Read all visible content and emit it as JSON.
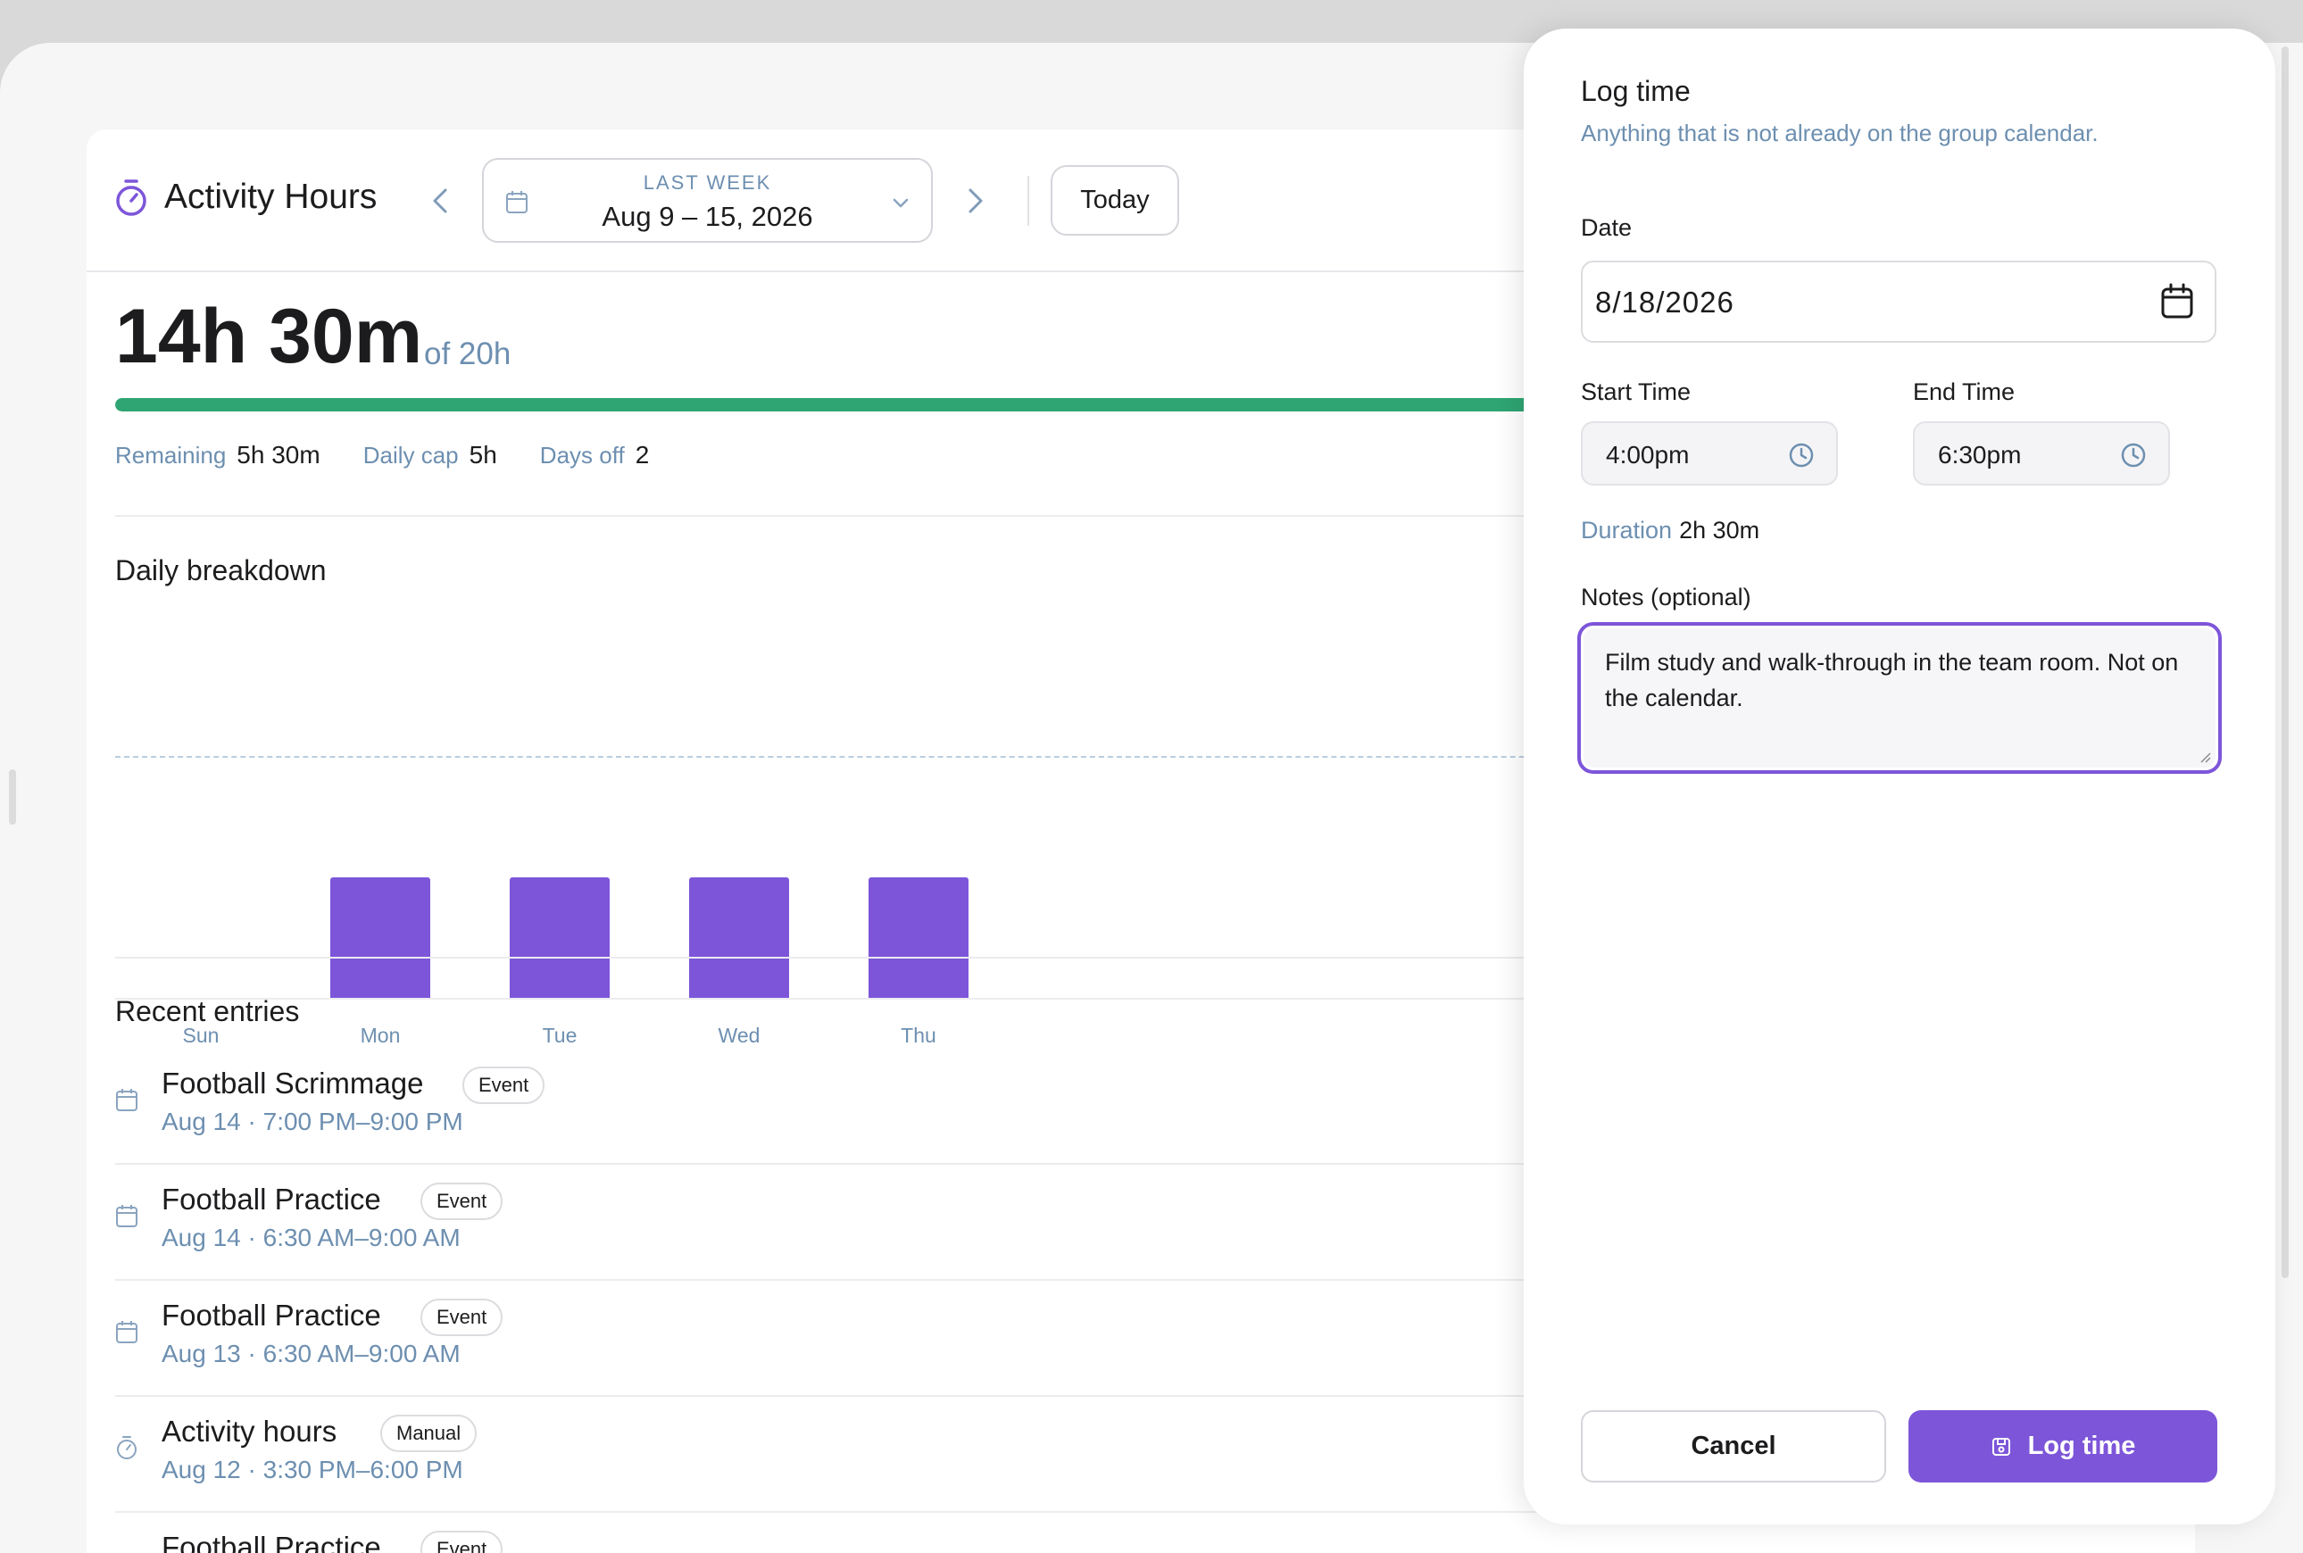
{
  "colors": {
    "accent": "#7d55d9",
    "progress": "#2ea572",
    "muted_text": "#6d8fb0",
    "text": "#1c1c1e",
    "border": "#d5d5db"
  },
  "header": {
    "icon": "stopwatch-icon",
    "title": "Activity Hours",
    "prev_icon": "chevron-left-icon",
    "next_icon": "chevron-right-icon",
    "week_select": {
      "icon": "calendar-icon",
      "caption": "LAST WEEK",
      "value": "Aug 9 – 15, 2026",
      "dropdown_icon": "chevron-down-icon"
    },
    "today_label": "Today"
  },
  "summary": {
    "total": "14h 30m",
    "of_total": "of 20h",
    "progress_fraction": 0.725,
    "stats": [
      {
        "label": "Remaining",
        "value": "5h 30m"
      },
      {
        "label": "Daily cap",
        "value": "5h"
      },
      {
        "label": "Days off",
        "value": "2"
      }
    ]
  },
  "breakdown": {
    "title": "Daily breakdown"
  },
  "chart_data": {
    "type": "bar",
    "categories": [
      "Sun",
      "Mon",
      "Tue",
      "Wed",
      "Thu"
    ],
    "values": [
      0,
      2.5,
      2.5,
      2.5,
      2.5
    ],
    "units": "hours",
    "daily_cap": 5,
    "ylim": [
      0,
      6
    ],
    "grid": false,
    "cap_line": "dashed"
  },
  "entries": {
    "title": "Recent entries",
    "items": [
      {
        "icon": "calendar-icon",
        "title": "Football Scrimmage",
        "tag": "Event",
        "subtitle": "Aug 14 · 7:00 PM–9:00 PM"
      },
      {
        "icon": "calendar-icon",
        "title": "Football Practice",
        "tag": "Event",
        "subtitle": "Aug 14 · 6:30 AM–9:00 AM"
      },
      {
        "icon": "calendar-icon",
        "title": "Football Practice",
        "tag": "Event",
        "subtitle": "Aug 13 · 6:30 AM–9:00 AM"
      },
      {
        "icon": "stopwatch-icon",
        "title": "Activity hours",
        "tag": "Manual",
        "subtitle": "Aug 12 · 3:30 PM–6:00 PM"
      },
      {
        "icon": "calendar-icon",
        "title": "Football Practice",
        "tag": "Event",
        "subtitle": ""
      }
    ]
  },
  "panel": {
    "title": "Log time",
    "subtitle": "Anything that is not already on the group calendar.",
    "date_label": "Date",
    "date_value": "8/18/2026",
    "date_icon": "calendar-icon",
    "start_label": "Start Time",
    "start_value": "4:00pm",
    "end_label": "End Time",
    "end_value": "6:30pm",
    "time_icon": "clock-icon",
    "duration_label": "Duration",
    "duration_value": "2h 30m",
    "notes_label": "Notes (optional)",
    "notes_value": "Film study and walk-through in the team room. Not on the calendar.",
    "cancel_label": "Cancel",
    "log_label": "Log time",
    "log_icon": "save-icon"
  }
}
